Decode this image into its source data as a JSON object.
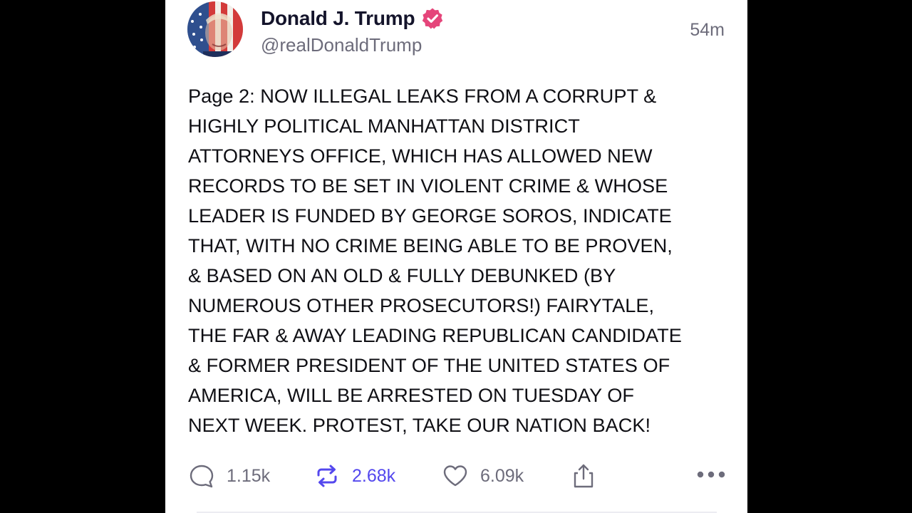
{
  "post": {
    "author": {
      "display_name": "Donald J. Trump",
      "handle": "@realDonaldTrump",
      "verified": true,
      "avatar_icon": "avatar-photo-flag-portrait"
    },
    "timestamp": "54m",
    "body_lines": [
      "Page 2: NOW ILLEGAL LEAKS FROM A CORRUPT &",
      "HIGHLY POLITICAL MANHATTAN DISTRICT",
      "ATTORNEYS OFFICE, WHICH HAS ALLOWED NEW",
      "RECORDS TO BE SET IN VIOLENT CRIME & WHOSE",
      "LEADER IS FUNDED BY GEORGE SOROS, INDICATE",
      "THAT, WITH NO CRIME BEING ABLE TO BE PROVEN,",
      "& BASED ON AN OLD & FULLY DEBUNKED (BY",
      "NUMEROUS OTHER PROSECUTORS!) FAIRYTALE,",
      "THE FAR & AWAY LEADING REPUBLICAN CANDIDATE",
      "& FORMER PRESIDENT OF THE UNITED STATES OF",
      "AMERICA, WILL BE ARRESTED ON TUESDAY OF",
      "NEXT WEEK. PROTEST, TAKE OUR NATION BACK!"
    ],
    "actions": {
      "replies": {
        "icon": "comment-bubble-icon",
        "count": "1.15k"
      },
      "rebroadcasts": {
        "icon": "repost-arrows-icon",
        "count": "2.68k"
      },
      "likes": {
        "icon": "heart-icon",
        "count": "6.09k"
      },
      "share": {
        "icon": "share-upload-icon"
      },
      "more": {
        "icon": "more-dots-icon"
      }
    }
  },
  "colors": {
    "background": "#000000",
    "card": "#ffffff",
    "text_primary": "#0f0f14",
    "text_secondary": "#6d6c7b",
    "verified_badge": "#e5457a",
    "accent": "#5448ee"
  }
}
